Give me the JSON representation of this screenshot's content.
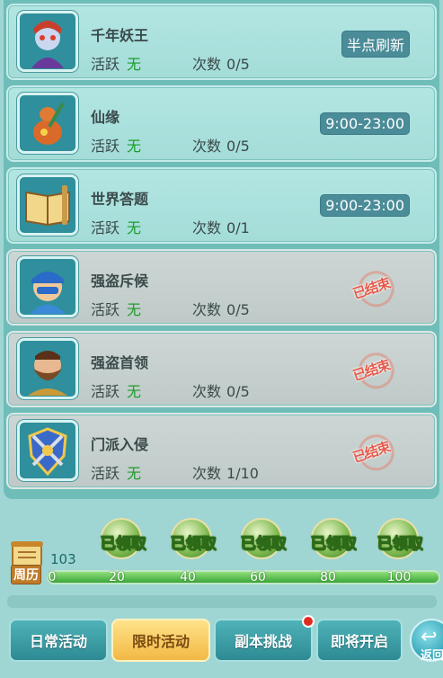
{
  "activities": [
    {
      "title": "千年妖王",
      "act_label": "活跃",
      "act_value": "无",
      "count_label": "次数",
      "count_value": "0/5",
      "status_type": "time",
      "status": "半点刷新",
      "icon": "demon-king-icon",
      "state": "active"
    },
    {
      "title": "仙缘",
      "act_label": "活跃",
      "act_value": "无",
      "count_label": "次数",
      "count_value": "0/5",
      "status_type": "time",
      "status": "9:00-23:00",
      "icon": "gourd-icon",
      "state": "active"
    },
    {
      "title": "世界答题",
      "act_label": "活跃",
      "act_value": "无",
      "count_label": "次数",
      "count_value": "0/1",
      "status_type": "time",
      "status": "9:00-23:00",
      "icon": "book-icon",
      "state": "active"
    },
    {
      "title": "强盗斥候",
      "act_label": "活跃",
      "act_value": "无",
      "count_label": "次数",
      "count_value": "0/5",
      "status_type": "ended",
      "status": "已结束",
      "icon": "bandit-scout-icon",
      "state": "ended"
    },
    {
      "title": "强盗首领",
      "act_label": "活跃",
      "act_value": "无",
      "count_label": "次数",
      "count_value": "0/5",
      "status_type": "ended",
      "status": "已结束",
      "icon": "bandit-leader-icon",
      "state": "ended"
    },
    {
      "title": "门派入侵",
      "act_label": "活跃",
      "act_value": "无",
      "count_label": "次数",
      "count_value": "1/10",
      "status_type": "ended",
      "status": "已结束",
      "icon": "sect-shield-icon",
      "state": "ended"
    }
  ],
  "calendar": {
    "label": "周历",
    "icon": "scroll-calendar-icon"
  },
  "score": "103",
  "progress": {
    "value": 103,
    "max": 100
  },
  "ticks": [
    "0",
    "20",
    "40",
    "60",
    "80",
    "100"
  ],
  "rewards": [
    {
      "label": "已领取",
      "threshold": 20
    },
    {
      "label": "已领取",
      "threshold": 40
    },
    {
      "label": "已领取",
      "threshold": 60
    },
    {
      "label": "已领取",
      "threshold": 80
    },
    {
      "label": "已领取",
      "threshold": 100
    }
  ],
  "tabs": [
    {
      "label": "日常活动",
      "selected": false,
      "badge": false
    },
    {
      "label": "限时活动",
      "selected": true,
      "badge": false
    },
    {
      "label": "副本挑战",
      "selected": false,
      "badge": true
    },
    {
      "label": "即将开启",
      "selected": false,
      "badge": false
    }
  ],
  "back": {
    "label": "返回",
    "icon": "back-arrow-icon"
  },
  "colors": {
    "active_value": "#1d9d2a",
    "time_badge": "#4a8c98",
    "stamp": "#e65a4a",
    "selected_tab": "#f2b944"
  }
}
